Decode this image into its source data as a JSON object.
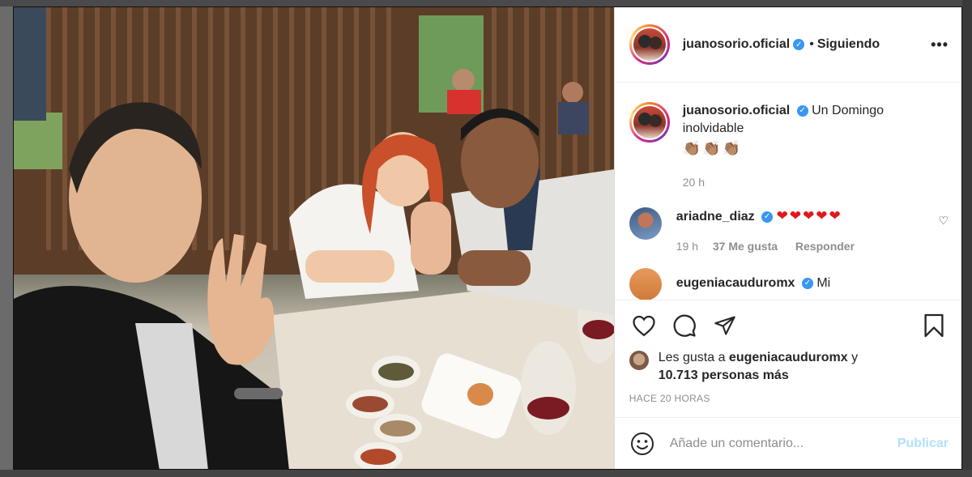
{
  "post": {
    "username": "juanosorio.oficial",
    "verified_icon": "verified-check-icon",
    "follow_separator": "•",
    "follow_status": "Siguiendo",
    "more_icon": "more-options-icon",
    "caption": "Un Domingo inolvidable",
    "caption_emoji": "👏🏽👏🏽👏🏽",
    "caption_time": "20 h",
    "timestamp": "HACE 20 HORAS"
  },
  "comments": [
    {
      "username": "ariadne_diaz",
      "text": "❤❤❤❤❤",
      "time": "19 h",
      "likes": "37 Me gusta",
      "reply": "Responder"
    },
    {
      "username": "eugeniacauduromx",
      "text": "Mi"
    }
  ],
  "likes": {
    "prefix": "Les gusta a",
    "user": "eugeniacauduromx",
    "suffix": "y",
    "others": "10.713 personas más"
  },
  "comment_box": {
    "placeholder": "Añade un comentario...",
    "publish": "Publicar"
  },
  "colors": {
    "accent": "#3897f0",
    "publish_disabled": "#b2dffc",
    "heart": "#e0181e",
    "muted": "#8e8e8e"
  }
}
